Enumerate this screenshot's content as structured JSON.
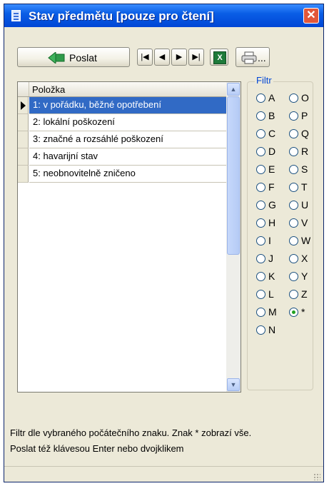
{
  "window": {
    "title": "Stav předmětu [pouze pro čtení]",
    "close_glyph": "✕"
  },
  "toolbar": {
    "send_label": "Poslat",
    "nav": [
      "|◀",
      "◀",
      "▶",
      "▶|"
    ],
    "excel_glyph": "X",
    "print_dots": "...",
    "icons": [
      "send-arrow-icon",
      "excel-icon",
      "printer-icon"
    ]
  },
  "grid": {
    "header": "Položka",
    "rows": [
      "1: v pořádku, běžné opotřebení",
      "2: lokální poškození",
      "3: značné a rozsáhlé poškození",
      "4: havarijní stav",
      "5: neobnovitelně zničeno"
    ],
    "selected_row": 0,
    "scroll_up": "▲",
    "scroll_down": "▼"
  },
  "filter": {
    "legend": "Filtr",
    "options": [
      "A",
      "O",
      "B",
      "P",
      "C",
      "Q",
      "D",
      "R",
      "E",
      "S",
      "F",
      "T",
      "G",
      "U",
      "H",
      "V",
      "I",
      "W",
      "J",
      "X",
      "K",
      "Y",
      "L",
      "Z",
      "M",
      "*",
      "N"
    ],
    "selected": "*"
  },
  "status": {
    "line1": "Filtr dle vybraného počátečního znaku. Znak * zobrazí vše.",
    "line2": "Poslat též klávesou Enter nebo dvojklikem"
  }
}
